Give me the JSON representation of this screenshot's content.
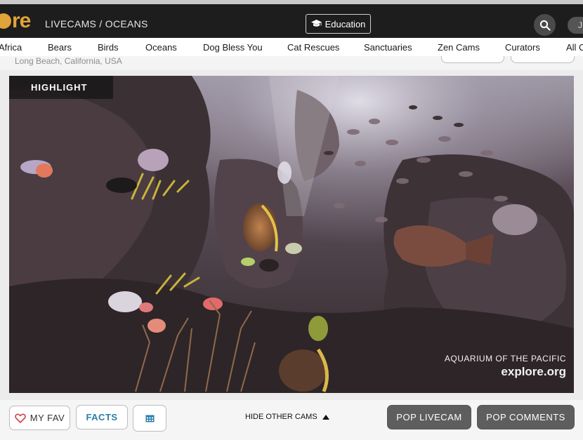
{
  "header": {
    "logo_text": "re",
    "breadcrumb": "LIVECAMS / OCEANS",
    "education_label": "Education",
    "right_pill_text": "J"
  },
  "nav": {
    "items": [
      "Africa",
      "Bears",
      "Birds",
      "Oceans",
      "Dog Bless You",
      "Cat Rescues",
      "Sanctuaries",
      "Zen Cams",
      "Curators",
      "All C"
    ]
  },
  "cam": {
    "location": "Long Beach, California, USA",
    "highlight_label": "HIGHLIGHT",
    "watermark_line1": "AQUARIUM OF THE PACIFIC",
    "watermark_line2": "explore.org"
  },
  "controls": {
    "fav_label": "MY FAV",
    "facts_label": "FACTS",
    "hide_other_cams_label": "HIDE OTHER CAMS",
    "pop_livecam_label": "POP LIVECAM",
    "pop_comments_label": "POP COMMENTS"
  },
  "colors": {
    "brand": "#e0a43a",
    "header_bg": "#1d1d1d",
    "facts_text": "#2b7fa8",
    "fav_heart": "#d0404a",
    "dark_button": "#5e5e5e"
  },
  "icons": {
    "education": "graduation-cap-icon",
    "search": "search-icon",
    "fav": "heart-icon",
    "calendar": "calendar-icon",
    "hide_cams": "caret-up-icon"
  }
}
